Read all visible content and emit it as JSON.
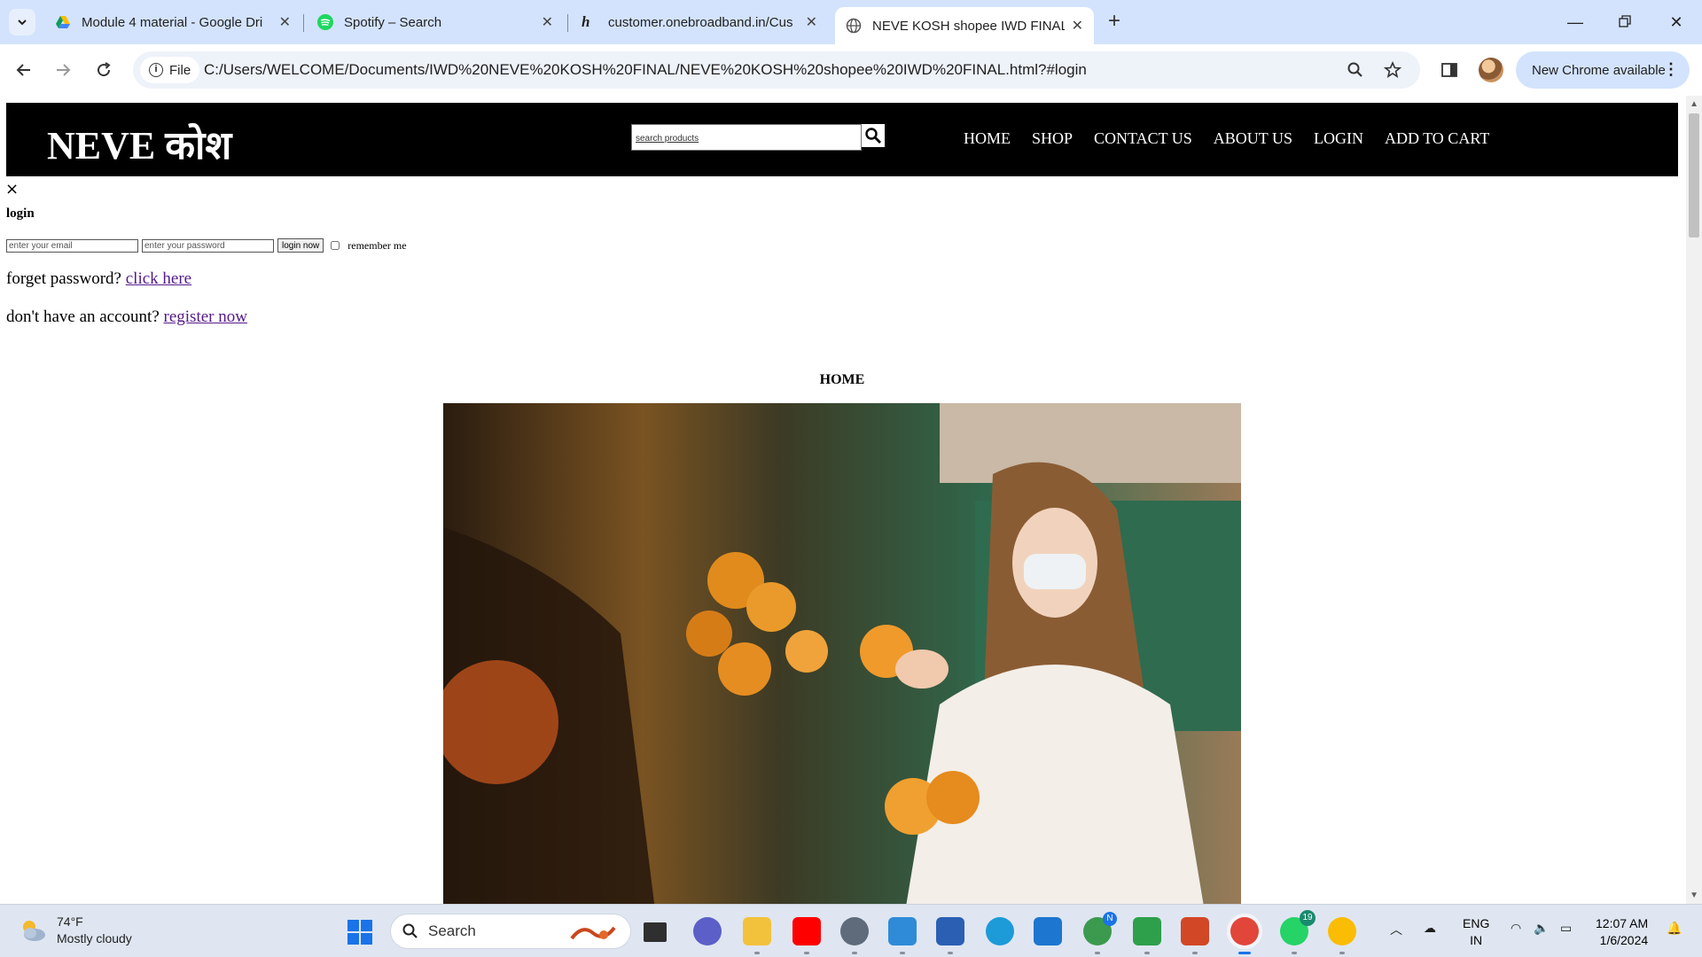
{
  "browser": {
    "tabs": [
      {
        "title": "Module 4 material - Google Dri",
        "icon": "google-drive-icon"
      },
      {
        "title": "Spotify – Search",
        "icon": "spotify-icon"
      },
      {
        "title": "customer.onebroadband.in/Cus",
        "icon": "hathway-icon"
      },
      {
        "title": "NEVE KOSH shopee IWD FINAL",
        "icon": "globe-icon"
      }
    ],
    "site_chip": "File",
    "url": "C:/Users/WELCOME/Documents/IWD%20NEVE%20KOSH%20FINAL/NEVE%20KOSH%20shopee%20IWD%20FINAL.html?#login",
    "update_label": "New Chrome available"
  },
  "page": {
    "logo": "NEVE कोश",
    "search_placeholder": "search products",
    "nav": [
      "HOME",
      "SHOP",
      "CONTACT US",
      "ABOUT US",
      "LOGIN",
      "ADD TO CART"
    ],
    "close_symbol": "×",
    "login": {
      "title": "login",
      "email_placeholder": "enter your email",
      "password_placeholder": "enter your password",
      "button": "login now",
      "remember": "remember me",
      "forget_text": "forget password?",
      "forget_link": "click here",
      "account_text": "don't have an account?",
      "account_link": "register now"
    },
    "home_heading": "HOME"
  },
  "taskbar": {
    "weather_temp": "74°F",
    "weather_desc": "Mostly cloudy",
    "search_label": "Search",
    "lang_top": "ENG",
    "lang_bottom": "IN",
    "time": "12:07 AM",
    "date": "1/6/2024",
    "badge_chrome": "N",
    "badge_whatsapp": "19"
  },
  "colors": {
    "tabstrip": "#d3e3fd",
    "site_header": "#000000",
    "link": "#551a8b",
    "taskbar": "#dfe6f1"
  }
}
